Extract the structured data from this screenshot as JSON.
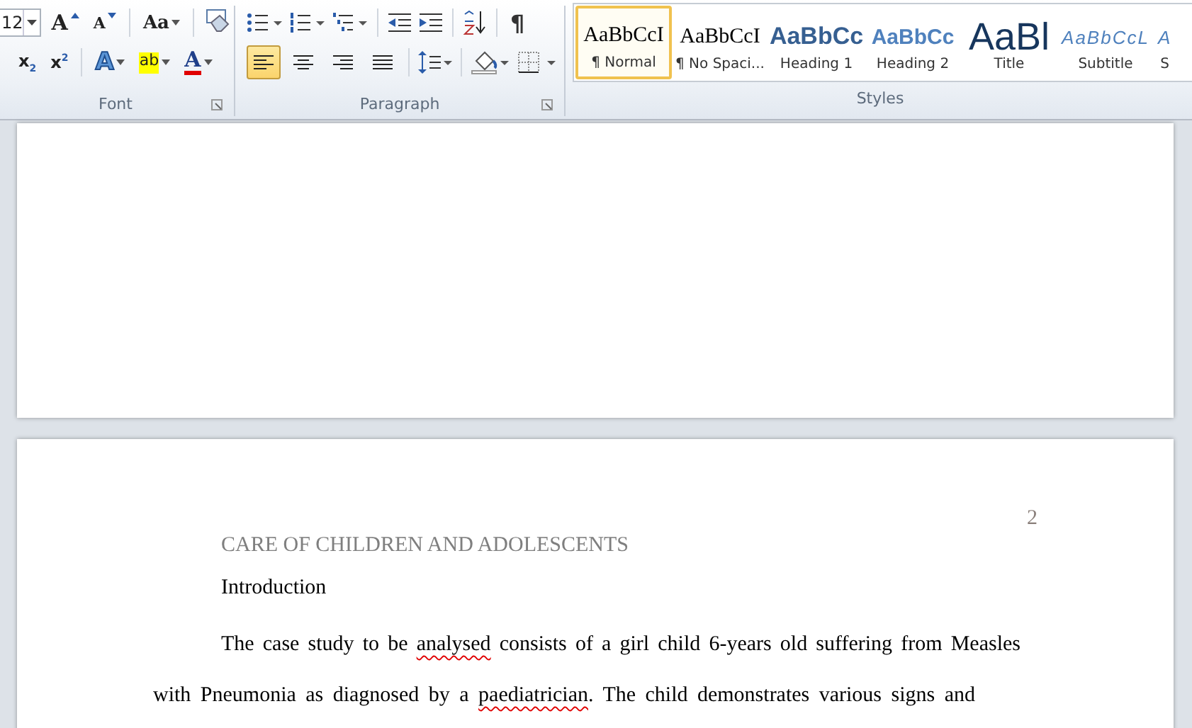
{
  "ribbon": {
    "font": {
      "label": "Font",
      "size": "12",
      "grow_glyph": "A",
      "shrink_glyph": "A",
      "change_case": "Aa",
      "subscript": "x$_{2}$",
      "superscript": "x$^{2}$",
      "text_effects": "A",
      "highlight": "ab",
      "font_color": "A"
    },
    "paragraph": {
      "label": "Paragraph",
      "show_marks": "¶",
      "alignments": [
        {
          "selected": true
        },
        {
          "selected": false
        },
        {
          "selected": false
        },
        {
          "selected": false
        }
      ]
    },
    "styles": {
      "label": "Styles",
      "items": [
        {
          "preview": "AaBbCcI",
          "name": "¶ Normal",
          "kind": "normal",
          "selected": true
        },
        {
          "preview": "AaBbCcI",
          "name": "¶ No Spaci...",
          "kind": "normal",
          "selected": false
        },
        {
          "preview": "AaBbCc",
          "name": "Heading 1",
          "kind": "heading1",
          "selected": false
        },
        {
          "preview": "AaBbCc",
          "name": "Heading 2",
          "kind": "heading2",
          "selected": false
        },
        {
          "preview": "AaBl",
          "name": "Title",
          "kind": "title",
          "selected": false
        },
        {
          "preview": "AaBbCcL",
          "name": "Subtitle",
          "kind": "subtitle",
          "selected": false
        },
        {
          "preview": "A",
          "name": "S",
          "kind": "subtitle",
          "selected": false
        }
      ]
    }
  },
  "document": {
    "page_number": "2",
    "header": "CARE OF CHILDREN AND ADOLESCENTS",
    "heading": "Introduction",
    "paragraph_lines": [
      {
        "segments": [
          {
            "text": "The case study to be ",
            "misspelled": false
          },
          {
            "text": "analysed",
            "misspelled": true
          },
          {
            "text": " consists of a girl child 6-years old suffering from Measles",
            "misspelled": false
          }
        ]
      },
      {
        "segments": [
          {
            "text": "with Pneumonia as diagnosed by a ",
            "misspelled": false
          },
          {
            "text": "paediatrician",
            "misspelled": true
          },
          {
            "text": ". The child demonstrates various signs and",
            "misspelled": false
          }
        ]
      }
    ]
  }
}
